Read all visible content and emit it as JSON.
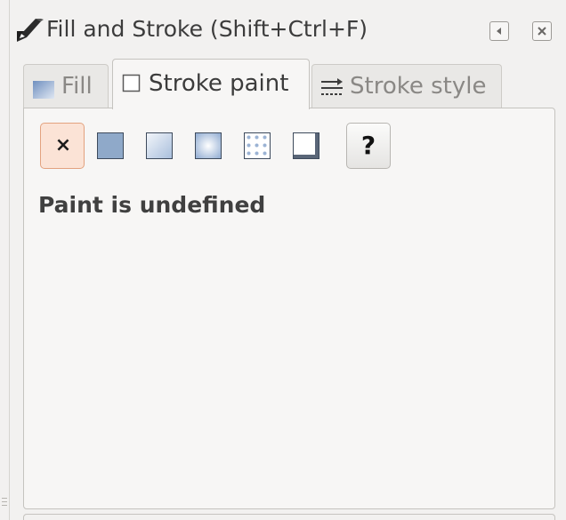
{
  "window": {
    "title": "Fill and Stroke (Shift+Ctrl+F)"
  },
  "tabs": [
    {
      "label": "Fill",
      "icon": "fill-swatch-icon",
      "active": false
    },
    {
      "label": "Stroke paint",
      "icon": "stroke-paint-checkbox-icon",
      "active": true
    },
    {
      "label": "Stroke style",
      "icon": "stroke-style-lines-icon",
      "active": false
    }
  ],
  "paint_modes": [
    {
      "name": "no-paint",
      "glyph": "×",
      "selected": true
    },
    {
      "name": "flat-color",
      "icon": "flat-color-icon"
    },
    {
      "name": "linear-gradient",
      "icon": "linear-gradient-icon"
    },
    {
      "name": "radial-gradient",
      "icon": "radial-gradient-icon"
    },
    {
      "name": "pattern",
      "icon": "pattern-icon"
    },
    {
      "name": "swatch",
      "icon": "swatch-icon"
    },
    {
      "name": "unset-paint",
      "glyph": "?"
    }
  ],
  "status": {
    "text": "Paint is undefined"
  },
  "colors": {
    "selected_button_bg": "#fbe3d6",
    "selected_button_border": "#e3a27f",
    "swatch_blue": "#8fa9c9"
  }
}
